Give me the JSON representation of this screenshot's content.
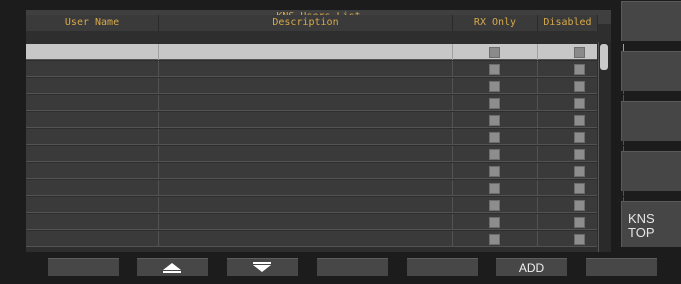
{
  "list": {
    "title": "KNS Users List",
    "columns": [
      "User Name",
      "Description",
      "RX Only",
      "Disabled"
    ]
  },
  "side_buttons": [
    "",
    "",
    "",
    "",
    "KNS\nTOP"
  ],
  "bottom_buttons": [
    "",
    "▲",
    "▼",
    "",
    "",
    "ADD",
    ""
  ],
  "rows_count_visible": 12,
  "colors": {
    "header_text": "#d8a94a",
    "selected_row": "#c7c7c7",
    "row_bg": "#3a3a3a"
  }
}
